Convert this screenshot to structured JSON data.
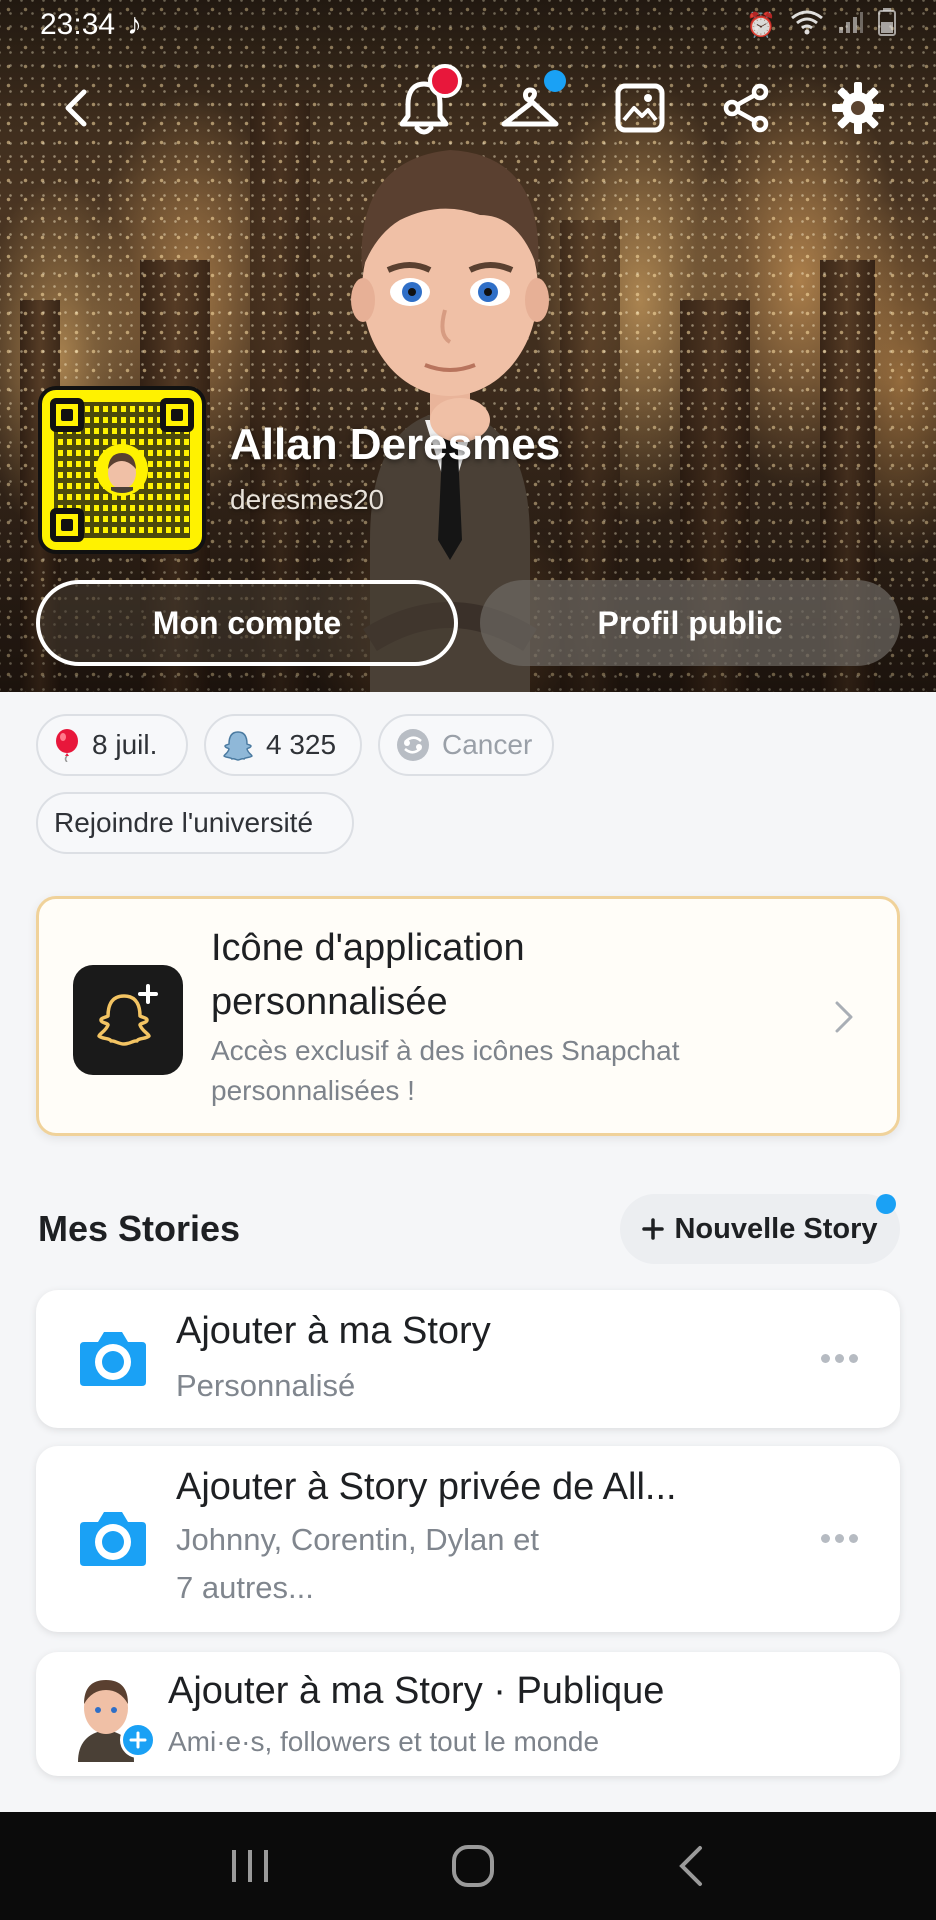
{
  "status_bar": {
    "time": "23:34",
    "app_glyph": "tiktok-icon"
  },
  "header": {
    "icons": [
      "back-icon",
      "notifications-bell-icon",
      "outfit-hanger-icon",
      "background-image-icon",
      "share-icon",
      "settings-gear-icon"
    ],
    "badge_colors": {
      "notification": "#e8173b",
      "outfit": "#1aa1f5"
    }
  },
  "profile": {
    "name": "Allan Deresmes",
    "username": "deresmes20"
  },
  "buttons": {
    "account": "Mon compte",
    "public_profile": "Profil public"
  },
  "chips": {
    "birthday": "8 juil.",
    "score": "4 325",
    "zodiac": "Cancer",
    "university": "Rejoindre l'université"
  },
  "promo": {
    "title": "Icône d'application personnalisée",
    "description": "Accès exclusif à des icônes Snapchat personnalisées !"
  },
  "stories": {
    "section_title": "Mes Stories",
    "new_story_label": "Nouvelle Story",
    "items": [
      {
        "title": "Ajouter à ma Story",
        "subtitle": "Personnalisé"
      },
      {
        "title": "Ajouter à Story privée de All...",
        "subtitle_line1": "Johnny, Corentin, Dylan et",
        "subtitle_line2": "7 autres..."
      },
      {
        "title": "Ajouter à ma Story · Publique",
        "subtitle": "Ami·e·s, followers et tout le monde"
      }
    ]
  },
  "colors": {
    "accent_blue": "#1aa1f5",
    "snap_yellow": "#fff200",
    "camera_blue": "#1aa1f5"
  }
}
